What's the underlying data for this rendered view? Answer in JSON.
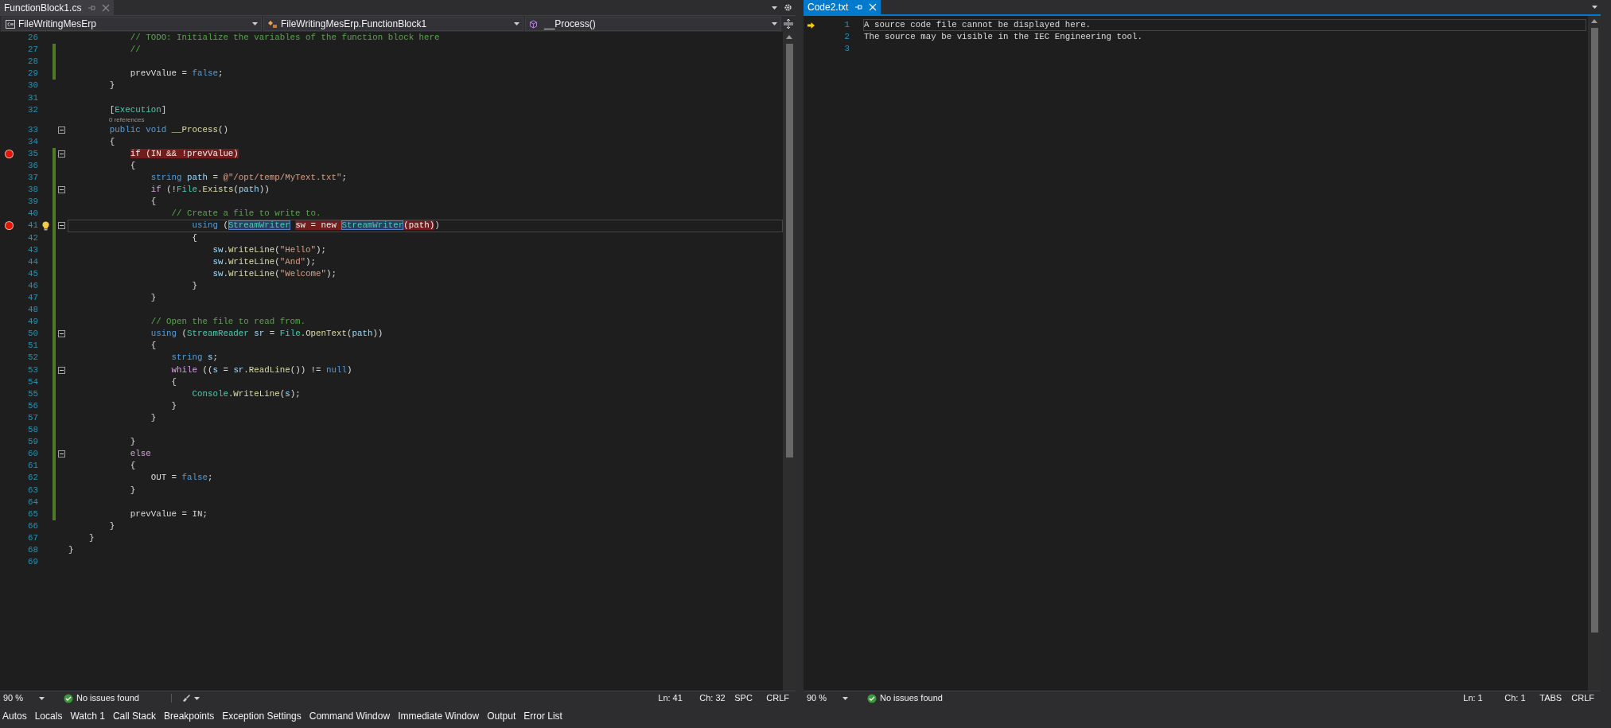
{
  "left_pane": {
    "tabs": [
      {
        "label": "FunctionBlock1.cs",
        "selected": false
      }
    ],
    "navigation": {
      "project": "FileWritingMesErp",
      "type": "FileWritingMesErp.FunctionBlock1",
      "member": "__Process()"
    },
    "editor": {
      "lines": [
        {
          "kind": "code",
          "number": "26",
          "tokens": [
            {
              "text": "            // TODO: Initialize the variables of the function block here",
              "kind": "comment"
            }
          ],
          "breakpoint": false,
          "changed": false,
          "fold": false,
          "lightbulb": false,
          "current": false
        },
        {
          "kind": "code",
          "number": "27",
          "tokens": [
            {
              "text": "            //",
              "kind": "comment"
            }
          ],
          "breakpoint": false,
          "changed": true,
          "fold": false,
          "lightbulb": false,
          "current": false
        },
        {
          "kind": "code",
          "number": "28",
          "breakpoint": false,
          "changed": true,
          "fold": false,
          "lightbulb": false,
          "current": false
        },
        {
          "kind": "code",
          "number": "29",
          "tokens": [
            {
              "text": "            prevValue = ",
              "kind": "plain"
            },
            {
              "text": "false",
              "kind": "keyword"
            },
            {
              "text": ";",
              "kind": "plain"
            }
          ],
          "breakpoint": false,
          "changed": true,
          "fold": false,
          "lightbulb": false,
          "current": false
        },
        {
          "kind": "code",
          "number": "30",
          "tokens": [
            {
              "text": "        }",
              "kind": "plain"
            }
          ],
          "breakpoint": false,
          "changed": false,
          "fold": false,
          "lightbulb": false,
          "current": false
        },
        {
          "kind": "code",
          "number": "31",
          "breakpoint": false,
          "changed": false,
          "fold": false,
          "lightbulb": false,
          "current": false
        },
        {
          "kind": "code",
          "number": "32",
          "tokens": [
            {
              "text": "        [",
              "kind": "plain"
            },
            {
              "text": "Execution",
              "kind": "type"
            },
            {
              "text": "]",
              "kind": "plain"
            }
          ],
          "breakpoint": false,
          "changed": false,
          "fold": false,
          "lightbulb": false,
          "current": false
        },
        {
          "kind": "codelens",
          "text": "0 references"
        },
        {
          "kind": "code",
          "number": "33",
          "tokens": [
            {
              "text": "        public void ",
              "kind": "keyword"
            },
            {
              "text": "__Process",
              "kind": "method"
            },
            {
              "text": "()",
              "kind": "plain"
            }
          ],
          "breakpoint": false,
          "changed": false,
          "fold": true,
          "lightbulb": false,
          "current": false
        },
        {
          "kind": "code",
          "number": "34",
          "tokens": [
            {
              "text": "        {",
              "kind": "plain"
            }
          ],
          "breakpoint": false,
          "changed": false,
          "fold": false,
          "lightbulb": false,
          "current": false
        },
        {
          "kind": "code",
          "number": "35",
          "tokens": [
            {
              "text": "            if (IN && !prevValue)",
              "kind": "breakpoint"
            }
          ],
          "breakpoint": true,
          "changed": true,
          "fold": true,
          "lightbulb": false,
          "current": false
        },
        {
          "kind": "code",
          "number": "36",
          "tokens": [
            {
              "text": "            {",
              "kind": "plain"
            }
          ],
          "breakpoint": false,
          "changed": true,
          "fold": false,
          "lightbulb": false,
          "current": false
        },
        {
          "kind": "code",
          "number": "37",
          "tokens": [
            {
              "text": "                string ",
              "kind": "keyword"
            },
            {
              "text": "path",
              "kind": "variable"
            },
            {
              "text": " = ",
              "kind": "plain"
            },
            {
              "text": "@\"/opt/temp/MyText.txt\"",
              "kind": "string"
            },
            {
              "text": ";",
              "kind": "plain"
            }
          ],
          "breakpoint": false,
          "changed": true,
          "fold": false,
          "lightbulb": false,
          "current": false
        },
        {
          "kind": "code",
          "number": "38",
          "tokens": [
            {
              "text": "                if",
              "kind": "control"
            },
            {
              "text": " (!",
              "kind": "plain"
            },
            {
              "text": "File",
              "kind": "type"
            },
            {
              "text": ".",
              "kind": "plain"
            },
            {
              "text": "Exists",
              "kind": "method"
            },
            {
              "text": "(",
              "kind": "plain"
            },
            {
              "text": "path",
              "kind": "variable"
            },
            {
              "text": "))",
              "kind": "plain"
            }
          ],
          "breakpoint": false,
          "changed": true,
          "fold": true,
          "lightbulb": false,
          "current": false
        },
        {
          "kind": "code",
          "number": "39",
          "tokens": [
            {
              "text": "                {",
              "kind": "plain"
            }
          ],
          "breakpoint": false,
          "changed": true,
          "fold": false,
          "lightbulb": false,
          "current": false
        },
        {
          "kind": "code",
          "number": "40",
          "tokens": [
            {
              "text": "                    // Create a file to write to.",
              "kind": "comment"
            }
          ],
          "breakpoint": false,
          "changed": true,
          "fold": false,
          "lightbulb": false,
          "current": false
        },
        {
          "kind": "code",
          "number": "41",
          "tokens": [
            {
              "text": "                        using",
              "kind": "keyword"
            },
            {
              "text": " (",
              "kind": "plain"
            },
            {
              "text": "StreamWriter",
              "kind": "reference"
            },
            {
              "text": " sw = new ",
              "kind": "breakpoint"
            },
            {
              "text": "StreamWriter",
              "kind": "reference"
            },
            {
              "text": "(path)",
              "kind": "breakpoint"
            },
            {
              "text": ")",
              "kind": "plain"
            }
          ],
          "breakpoint": true,
          "changed": true,
          "fold": true,
          "lightbulb": true,
          "current": true
        },
        {
          "kind": "code",
          "number": "42",
          "tokens": [
            {
              "text": "                        {",
              "kind": "plain"
            }
          ],
          "breakpoint": false,
          "changed": true,
          "fold": false,
          "lightbulb": false,
          "current": false
        },
        {
          "kind": "code",
          "number": "43",
          "tokens": [
            {
              "text": "                            sw",
              "kind": "variable"
            },
            {
              "text": ".",
              "kind": "plain"
            },
            {
              "text": "WriteLine",
              "kind": "method"
            },
            {
              "text": "(",
              "kind": "plain"
            },
            {
              "text": "\"Hello\"",
              "kind": "string"
            },
            {
              "text": ");",
              "kind": "plain"
            }
          ],
          "breakpoint": false,
          "changed": true,
          "fold": false,
          "lightbulb": false,
          "current": false
        },
        {
          "kind": "code",
          "number": "44",
          "tokens": [
            {
              "text": "                            sw",
              "kind": "variable"
            },
            {
              "text": ".",
              "kind": "plain"
            },
            {
              "text": "WriteLine",
              "kind": "method"
            },
            {
              "text": "(",
              "kind": "plain"
            },
            {
              "text": "\"And\"",
              "kind": "string"
            },
            {
              "text": ");",
              "kind": "plain"
            }
          ],
          "breakpoint": false,
          "changed": true,
          "fold": false,
          "lightbulb": false,
          "current": false
        },
        {
          "kind": "code",
          "number": "45",
          "tokens": [
            {
              "text": "                            sw",
              "kind": "variable"
            },
            {
              "text": ".",
              "kind": "plain"
            },
            {
              "text": "WriteLine",
              "kind": "method"
            },
            {
              "text": "(",
              "kind": "plain"
            },
            {
              "text": "\"Welcome\"",
              "kind": "string"
            },
            {
              "text": ");",
              "kind": "plain"
            }
          ],
          "breakpoint": false,
          "changed": true,
          "fold": false,
          "lightbulb": false,
          "current": false
        },
        {
          "kind": "code",
          "number": "46",
          "tokens": [
            {
              "text": "                        }",
              "kind": "plain"
            }
          ],
          "breakpoint": false,
          "changed": true,
          "fold": false,
          "lightbulb": false,
          "current": false
        },
        {
          "kind": "code",
          "number": "47",
          "tokens": [
            {
              "text": "                }",
              "kind": "plain"
            }
          ],
          "breakpoint": false,
          "changed": true,
          "fold": false,
          "lightbulb": false,
          "current": false
        },
        {
          "kind": "code",
          "number": "48",
          "breakpoint": false,
          "changed": true,
          "fold": false,
          "lightbulb": false,
          "current": false
        },
        {
          "kind": "code",
          "number": "49",
          "tokens": [
            {
              "text": "                // Open the file to read from.",
              "kind": "comment"
            }
          ],
          "breakpoint": false,
          "changed": true,
          "fold": false,
          "lightbulb": false,
          "current": false
        },
        {
          "kind": "code",
          "number": "50",
          "tokens": [
            {
              "text": "                using",
              "kind": "keyword"
            },
            {
              "text": " (",
              "kind": "plain"
            },
            {
              "text": "StreamReader",
              "kind": "type"
            },
            {
              "text": " sr",
              "kind": "variable"
            },
            {
              "text": " = ",
              "kind": "plain"
            },
            {
              "text": "File",
              "kind": "type"
            },
            {
              "text": ".",
              "kind": "plain"
            },
            {
              "text": "OpenText",
              "kind": "method"
            },
            {
              "text": "(",
              "kind": "plain"
            },
            {
              "text": "path",
              "kind": "variable"
            },
            {
              "text": "))",
              "kind": "plain"
            }
          ],
          "breakpoint": false,
          "changed": true,
          "fold": true,
          "lightbulb": false,
          "current": false
        },
        {
          "kind": "code",
          "number": "51",
          "tokens": [
            {
              "text": "                {",
              "kind": "plain"
            }
          ],
          "breakpoint": false,
          "changed": true,
          "fold": false,
          "lightbulb": false,
          "current": false
        },
        {
          "kind": "code",
          "number": "52",
          "tokens": [
            {
              "text": "                    string ",
              "kind": "keyword"
            },
            {
              "text": "s",
              "kind": "variable"
            },
            {
              "text": ";",
              "kind": "plain"
            }
          ],
          "breakpoint": false,
          "changed": true,
          "fold": false,
          "lightbulb": false,
          "current": false
        },
        {
          "kind": "code",
          "number": "53",
          "tokens": [
            {
              "text": "                    while",
              "kind": "control"
            },
            {
              "text": " ((",
              "kind": "plain"
            },
            {
              "text": "s",
              "kind": "variable"
            },
            {
              "text": " = ",
              "kind": "plain"
            },
            {
              "text": "sr",
              "kind": "variable"
            },
            {
              "text": ".",
              "kind": "plain"
            },
            {
              "text": "ReadLine",
              "kind": "method"
            },
            {
              "text": "()) != ",
              "kind": "plain"
            },
            {
              "text": "null",
              "kind": "keyword"
            },
            {
              "text": ")",
              "kind": "plain"
            }
          ],
          "breakpoint": false,
          "changed": true,
          "fold": true,
          "lightbulb": false,
          "current": false
        },
        {
          "kind": "code",
          "number": "54",
          "tokens": [
            {
              "text": "                    {",
              "kind": "plain"
            }
          ],
          "breakpoint": false,
          "changed": true,
          "fold": false,
          "lightbulb": false,
          "current": false
        },
        {
          "kind": "code",
          "number": "55",
          "tokens": [
            {
              "text": "                        Console",
              "kind": "type"
            },
            {
              "text": ".",
              "kind": "plain"
            },
            {
              "text": "WriteLine",
              "kind": "method"
            },
            {
              "text": "(",
              "kind": "plain"
            },
            {
              "text": "s",
              "kind": "variable"
            },
            {
              "text": ");",
              "kind": "plain"
            }
          ],
          "breakpoint": false,
          "changed": true,
          "fold": false,
          "lightbulb": false,
          "current": false
        },
        {
          "kind": "code",
          "number": "56",
          "tokens": [
            {
              "text": "                    }",
              "kind": "plain"
            }
          ],
          "breakpoint": false,
          "changed": true,
          "fold": false,
          "lightbulb": false,
          "current": false
        },
        {
          "kind": "code",
          "number": "57",
          "tokens": [
            {
              "text": "                }",
              "kind": "plain"
            }
          ],
          "breakpoint": false,
          "changed": true,
          "fold": false,
          "lightbulb": false,
          "current": false
        },
        {
          "kind": "code",
          "number": "58",
          "breakpoint": false,
          "changed": true,
          "fold": false,
          "lightbulb": false,
          "current": false
        },
        {
          "kind": "code",
          "number": "59",
          "tokens": [
            {
              "text": "            }",
              "kind": "plain"
            }
          ],
          "breakpoint": false,
          "changed": true,
          "fold": false,
          "lightbulb": false,
          "current": false
        },
        {
          "kind": "code",
          "number": "60",
          "tokens": [
            {
              "text": "            else",
              "kind": "control"
            }
          ],
          "breakpoint": false,
          "changed": true,
          "fold": true,
          "lightbulb": false,
          "current": false
        },
        {
          "kind": "code",
          "number": "61",
          "tokens": [
            {
              "text": "            {",
              "kind": "plain"
            }
          ],
          "breakpoint": false,
          "changed": true,
          "fold": false,
          "lightbulb": false,
          "current": false
        },
        {
          "kind": "code",
          "number": "62",
          "tokens": [
            {
              "text": "                OUT = ",
              "kind": "plain"
            },
            {
              "text": "false",
              "kind": "keyword"
            },
            {
              "text": ";",
              "kind": "plain"
            }
          ],
          "breakpoint": false,
          "changed": true,
          "fold": false,
          "lightbulb": false,
          "current": false
        },
        {
          "kind": "code",
          "number": "63",
          "tokens": [
            {
              "text": "            }",
              "kind": "plain"
            }
          ],
          "breakpoint": false,
          "changed": true,
          "fold": false,
          "lightbulb": false,
          "current": false
        },
        {
          "kind": "code",
          "number": "64",
          "breakpoint": false,
          "changed": true,
          "fold": false,
          "lightbulb": false,
          "current": false
        },
        {
          "kind": "code",
          "number": "65",
          "tokens": [
            {
              "text": "            prevValue = IN;",
              "kind": "plain"
            }
          ],
          "breakpoint": false,
          "changed": true,
          "fold": false,
          "lightbulb": false,
          "current": false
        },
        {
          "kind": "code",
          "number": "66",
          "tokens": [
            {
              "text": "        }",
              "kind": "plain"
            }
          ],
          "breakpoint": false,
          "changed": false,
          "fold": false,
          "lightbulb": false,
          "current": false
        },
        {
          "kind": "code",
          "number": "67",
          "tokens": [
            {
              "text": "    }",
              "kind": "plain"
            }
          ],
          "breakpoint": false,
          "changed": false,
          "fold": false,
          "lightbulb": false,
          "current": false
        },
        {
          "kind": "code",
          "number": "68",
          "tokens": [
            {
              "text": "}",
              "kind": "plain"
            }
          ],
          "breakpoint": false,
          "changed": false,
          "fold": false,
          "lightbulb": false,
          "current": false
        },
        {
          "kind": "code",
          "number": "69",
          "breakpoint": false,
          "changed": false,
          "fold": false,
          "lightbulb": false,
          "current": false
        }
      ]
    },
    "status_bar": {
      "zoom": "90 %",
      "issues": "No issues found",
      "cleanup_button": true,
      "line": "Ln: 41",
      "column": "Ch: 32",
      "indentation": "SPC",
      "line_ending": "CRLF"
    }
  },
  "right_pane": {
    "tabs": [
      {
        "label": "Code2.txt",
        "selected": true
      }
    ],
    "editor": {
      "lines": [
        {
          "number": "1",
          "text": "A source code file cannot be displayed here.",
          "current": true,
          "instruction_pointer": true
        },
        {
          "number": "2",
          "text": "The source may be visible in the IEC Engineering tool.",
          "current": false,
          "instruction_pointer": false
        },
        {
          "number": "3",
          "current": false,
          "instruction_pointer": false
        }
      ]
    },
    "status_bar": {
      "zoom": "90 %",
      "issues": "No issues found",
      "cleanup_button": false,
      "line": "Ln: 1",
      "column": "Ch: 1",
      "indentation": "TABS",
      "line_ending": "CRLF"
    }
  },
  "tool_tabs": [
    "Autos",
    "Locals",
    "Watch 1",
    "Call Stack",
    "Breakpoints",
    "Exception Settings",
    "Command Window",
    "Immediate Window",
    "Output",
    "Error List"
  ]
}
